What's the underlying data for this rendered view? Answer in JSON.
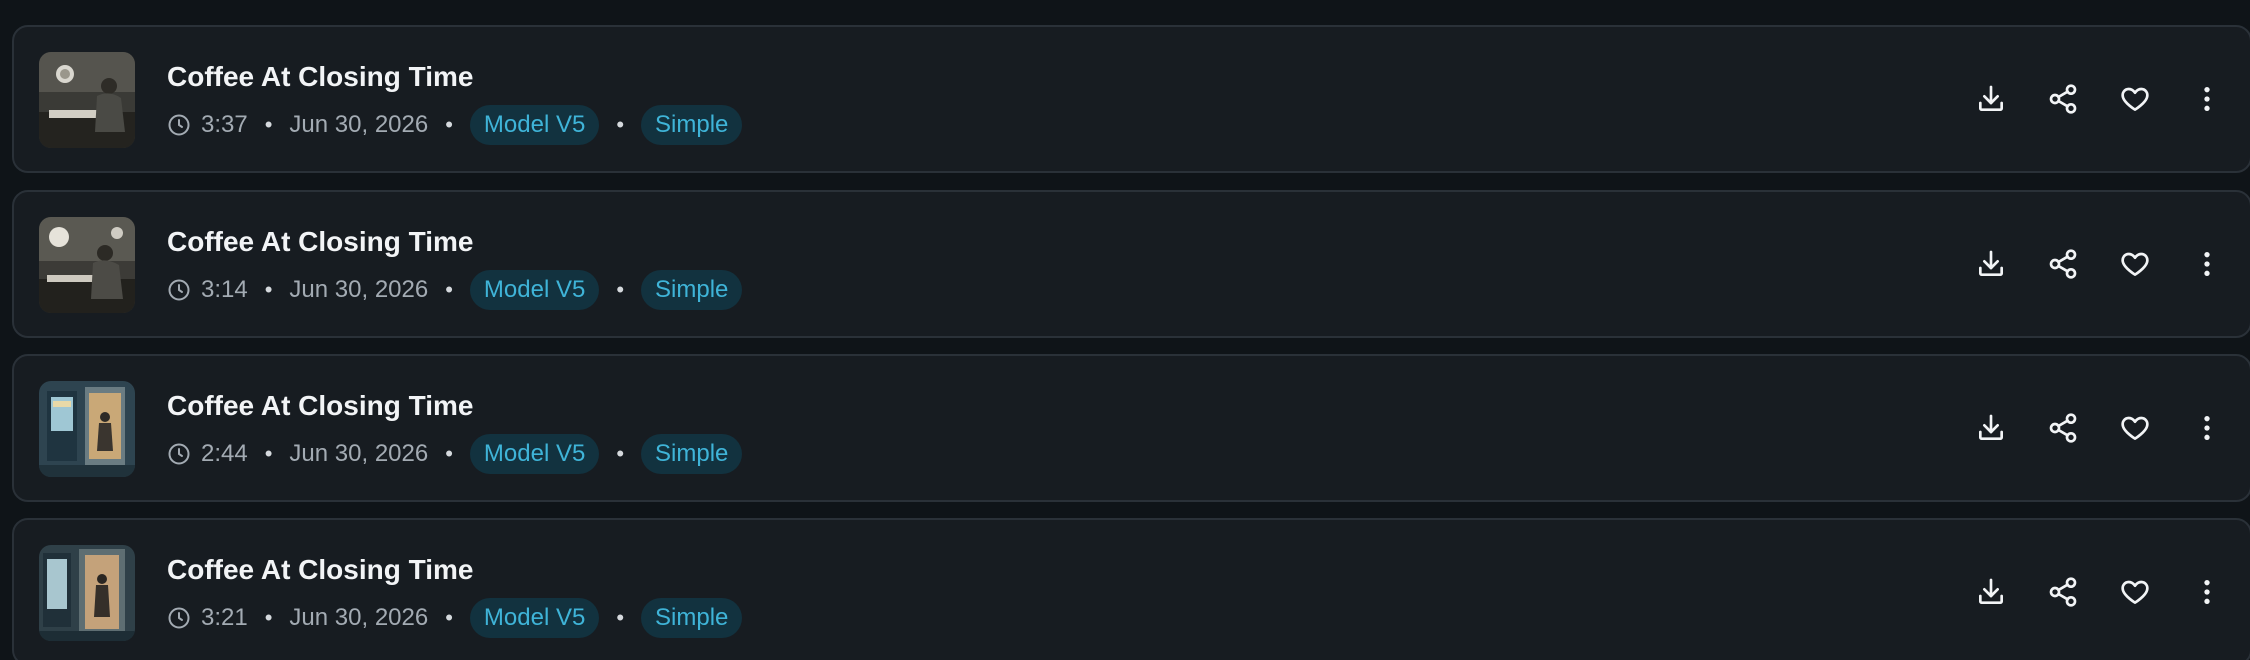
{
  "tracks": [
    {
      "title": "Coffee At Closing Time",
      "duration": "3:37",
      "date": "Jun 30, 2026",
      "model": "Model V5",
      "style": "Simple",
      "thumbnail": "thumbnail-1"
    },
    {
      "title": "Coffee At Closing Time",
      "duration": "3:14",
      "date": "Jun 30, 2026",
      "model": "Model V5",
      "style": "Simple",
      "thumbnail": "thumbnail-2"
    },
    {
      "title": "Coffee At Closing Time",
      "duration": "2:44",
      "date": "Jun 30, 2026",
      "model": "Model V5",
      "style": "Simple",
      "thumbnail": "thumbnail-3"
    },
    {
      "title": "Coffee At Closing Time",
      "duration": "3:21",
      "date": "Jun 30, 2026",
      "model": "Model V5",
      "style": "Simple",
      "thumbnail": "thumbnail-4"
    }
  ],
  "separator": "•",
  "icons": {
    "clock": "clock-icon",
    "download": "download-icon",
    "share": "share-icon",
    "like": "heart-icon",
    "more": "more-vertical-icon"
  },
  "colors": {
    "background": "#0f1418",
    "card": "#171c21",
    "badge_bg": "#12323f",
    "badge_text": "#3fb4d8"
  }
}
